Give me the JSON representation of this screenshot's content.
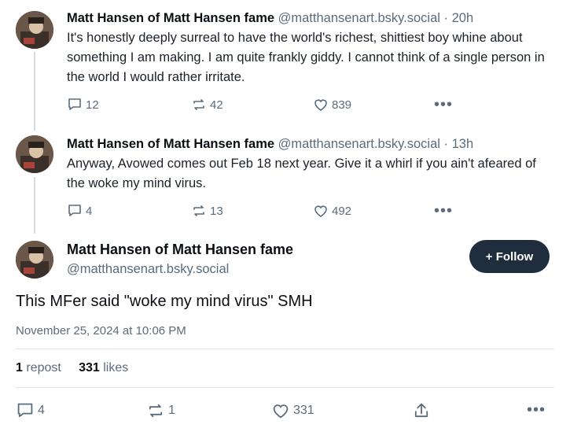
{
  "posts": [
    {
      "name": "Matt Hansen of Matt Hansen fame",
      "handle": "@matthansenart.bsky.social",
      "sep": "·",
      "time": "20h",
      "text": "It's honestly deeply surreal to have the world's richest, shittiest boy whine about something I am making. I am quite frankly giddy. I cannot think of a single person in the world I would rather irritate.",
      "replies": "12",
      "reposts": "42",
      "likes": "839",
      "more": "•••"
    },
    {
      "name": "Matt Hansen of Matt Hansen fame",
      "handle": "@matthansenart.bsky.social",
      "sep": "·",
      "time": "13h",
      "text": "Anyway, Avowed comes out Feb 18 next year. Give it a whirl if you ain't afeared of the woke my mind virus.",
      "replies": "4",
      "reposts": "13",
      "likes": "492",
      "more": "•••"
    }
  ],
  "main": {
    "name": "Matt Hansen of Matt Hansen fame",
    "handle": "@matthansenart.bsky.social",
    "follow_label": "+ Follow",
    "text": "This MFer said \"woke my mind virus\" SMH",
    "date": "November 25, 2024 at 10:06 PM",
    "repost_count": "1",
    "repost_label": "repost",
    "like_count": "331",
    "like_label": "likes",
    "replies": "4",
    "reposts": "1",
    "likes": "331",
    "more": "•••"
  },
  "icons": {
    "reply": "speech-bubble-icon",
    "repost": "repost-arrows-icon",
    "like": "heart-icon",
    "share": "share-icon",
    "more": "more-dots-icon"
  }
}
